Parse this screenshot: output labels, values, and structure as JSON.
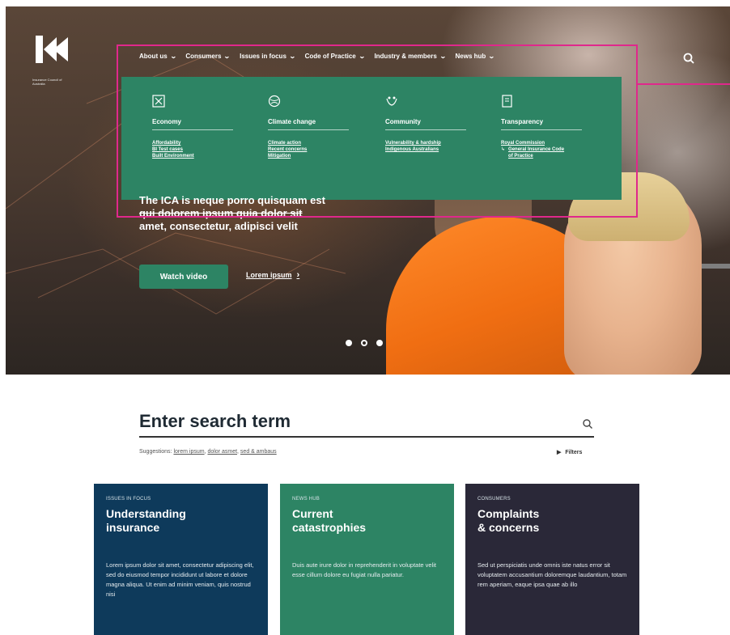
{
  "logo": {
    "caption": "Insurance Council of Australia"
  },
  "nav": {
    "items": [
      {
        "label": "About us"
      },
      {
        "label": "Consumers"
      },
      {
        "label": "Issues in focus"
      },
      {
        "label": "Code of Practice"
      },
      {
        "label": "Industry & members"
      },
      {
        "label": "News hub"
      }
    ]
  },
  "mega_menu": {
    "columns": [
      {
        "icon": "economy-icon",
        "heading": "Economy",
        "links": [
          "Affordability",
          "BI Test cases",
          "Built Environment"
        ]
      },
      {
        "icon": "climate-icon",
        "heading": "Climate change",
        "links": [
          "Climate action",
          "Recent concerns",
          "Mitigation"
        ]
      },
      {
        "icon": "community-icon",
        "heading": "Community",
        "links": [
          "Vulnerability & hardship",
          "Indigenous Australians"
        ]
      },
      {
        "icon": "transparency-icon",
        "heading": "Transparency",
        "links": [
          "Royal Commission"
        ],
        "sublink": "General Insurance Code of Practice"
      }
    ]
  },
  "hero": {
    "headline_line1": "The ICA is neque porro quisquam est",
    "headline_line2": "qui dolorem ipsum quia dolor sit",
    "headline_line3": "amet, consectetur, adipisci velit",
    "watch_label": "Watch video",
    "lorem_label": "Lorem ipsum",
    "slides": 3,
    "active_slide": 3
  },
  "search": {
    "title": "Enter search term",
    "suggestions_prefix": "Suggestions:",
    "suggestions": [
      "lorem ipsum",
      "dolor asmet",
      "sed & ambaus"
    ],
    "filters_label": "Filters"
  },
  "cards": [
    {
      "kicker": "ISSUES IN FOCUS",
      "title_line1": "Understanding",
      "title_line2": "insurance",
      "body": "Lorem ipsum dolor sit amet, consectetur adipiscing elit, sed do eiusmod tempor incididunt ut labore et dolore magna aliqua. Ut enim ad minim veniam, quis nostrud nisi"
    },
    {
      "kicker": "NEWS HUB",
      "title_line1": "Current",
      "title_line2": "catastrophies",
      "body": "Duis aute irure dolor in reprehenderit in voluptate velit esse cillum dolore eu fugiat nulla pariatur."
    },
    {
      "kicker": "CONSUMERS",
      "title_line1": "Complaints",
      "title_line2": "& concerns",
      "body": "Sed ut perspiciatis unde omnis iste natus error sit voluptatem accusantium doloremque laudantium, totam rem aperiam, eaque ipsa quae ab illo"
    }
  ],
  "colors": {
    "accent_green": "#2d8464",
    "navy": "#0e3a5b",
    "dark": "#2a2838",
    "highlight": "#e0288c"
  }
}
